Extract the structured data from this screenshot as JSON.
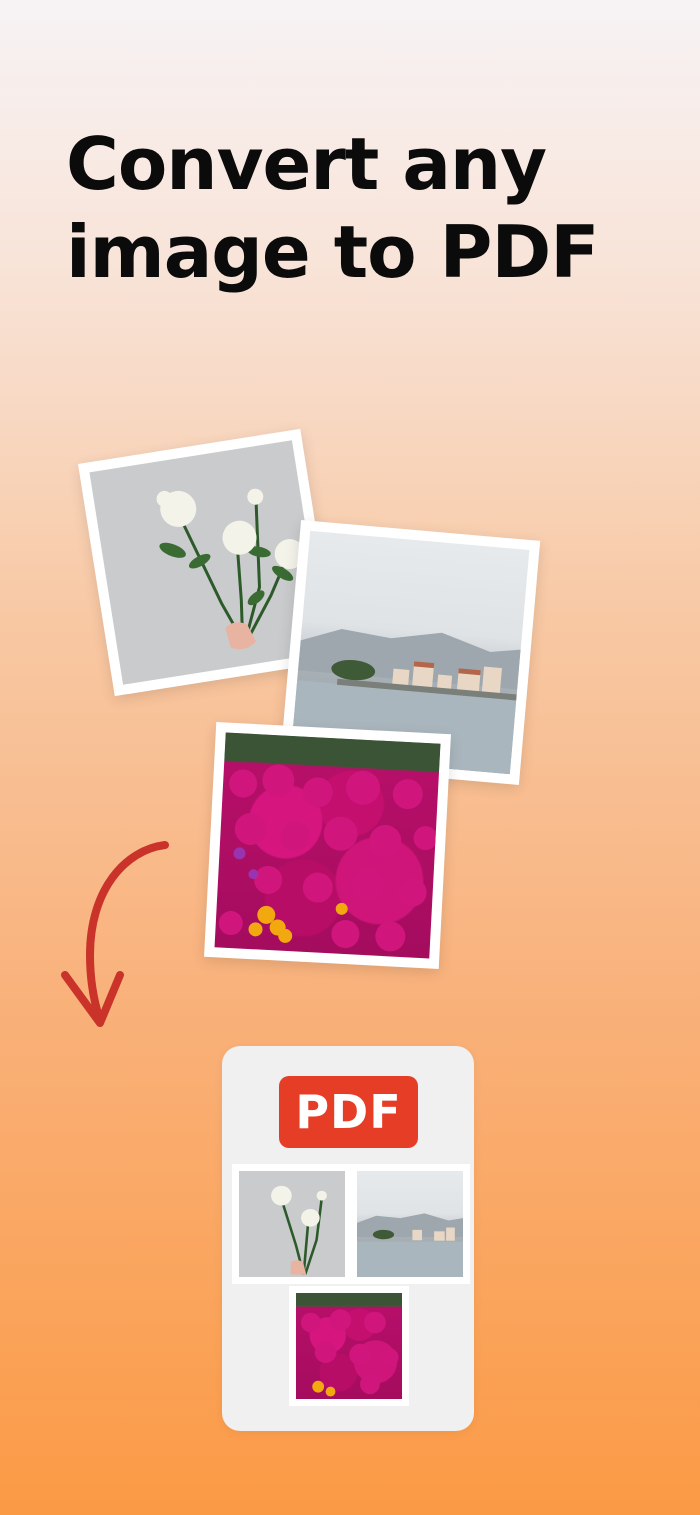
{
  "headline": {
    "line1": "Convert any",
    "line2": "image to PDF"
  },
  "pdf_card": {
    "badge_label": "PDF"
  },
  "photos": [
    {
      "name": "white-roses-photo"
    },
    {
      "name": "coastal-town-photo"
    },
    {
      "name": "magenta-flowers-photo"
    }
  ],
  "colors": {
    "badge": "#e63e26",
    "arrow": "#c9332a",
    "gradient_top": "#f7f3f5",
    "gradient_bottom": "#fb9a45"
  }
}
